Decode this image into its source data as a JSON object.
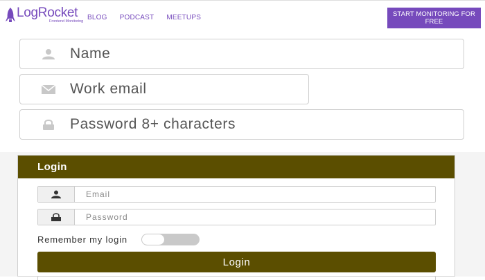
{
  "header": {
    "brand": "LogRocket",
    "tagline": "Frontend Monitoring",
    "nav": [
      "BLOG",
      "PODCAST",
      "MEETUPS"
    ],
    "cta_label": "START MONITORING FOR FREE",
    "accent_color": "#764abc"
  },
  "signup": {
    "name_placeholder": "Name",
    "email_placeholder": "Work email",
    "password_placeholder": "Password 8+ characters",
    "icons": [
      "user-icon",
      "envelope-icon",
      "lock-icon"
    ]
  },
  "login": {
    "title": "Login",
    "email_placeholder": "Email",
    "password_placeholder": "Password",
    "remember_label": "Remember my login",
    "remember_on": false,
    "button_label": "Login",
    "theme_color": "#5b4e00"
  }
}
